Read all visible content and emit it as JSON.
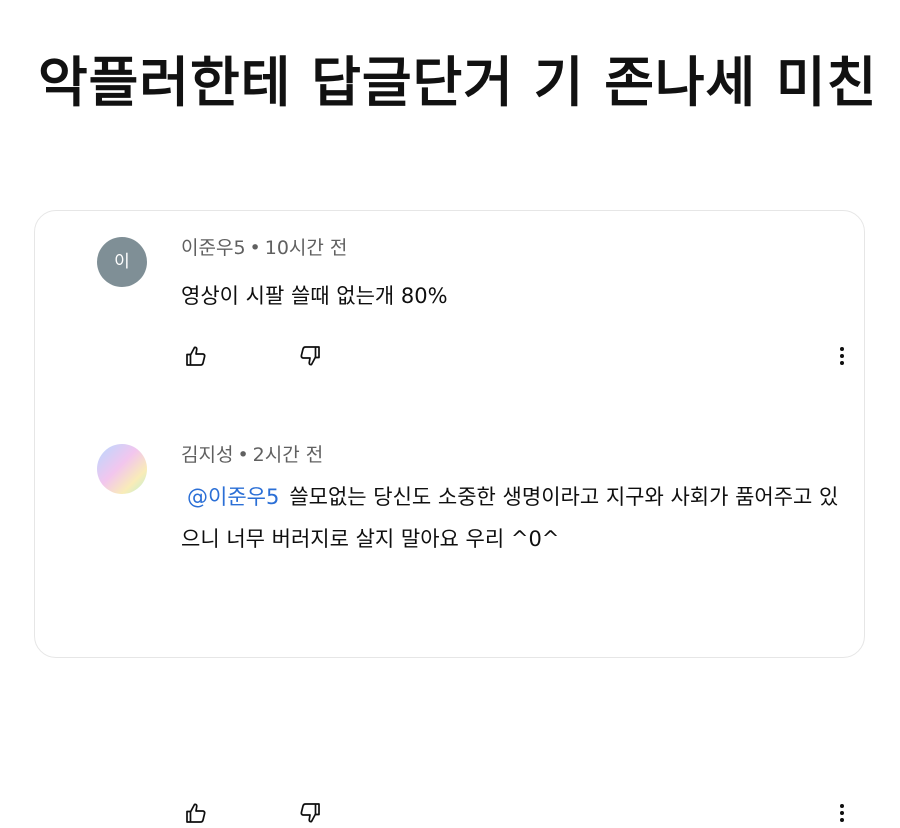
{
  "post": {
    "title": "악플러한테 답글단거 기 존나세 미친"
  },
  "comments": [
    {
      "author": "이준우5",
      "separator": "•",
      "time": "10시간 전",
      "avatar_letter": "이",
      "avatar_color": "#7f8f96",
      "mention": "",
      "text": "영상이 시팔  쓸때 없는개 80%",
      "icons": {
        "like": "thumb-up-icon",
        "dislike": "thumb-down-icon",
        "more": "more-vertical-icon"
      }
    },
    {
      "author": "김지성",
      "separator": "•",
      "time": "2시간 전",
      "avatar_letter": "",
      "mention": "@이준우5",
      "mention_color": "#2b6fd6",
      "text": "쓸모없는 당신도 소중한 생명이라고 지구와 사회가 품어주고 있으니 너무 버러지로 살지 말아요 우리 ^0^",
      "icons": {
        "like": "thumb-up-icon",
        "dislike": "thumb-down-icon",
        "more": "more-vertical-icon"
      }
    }
  ]
}
